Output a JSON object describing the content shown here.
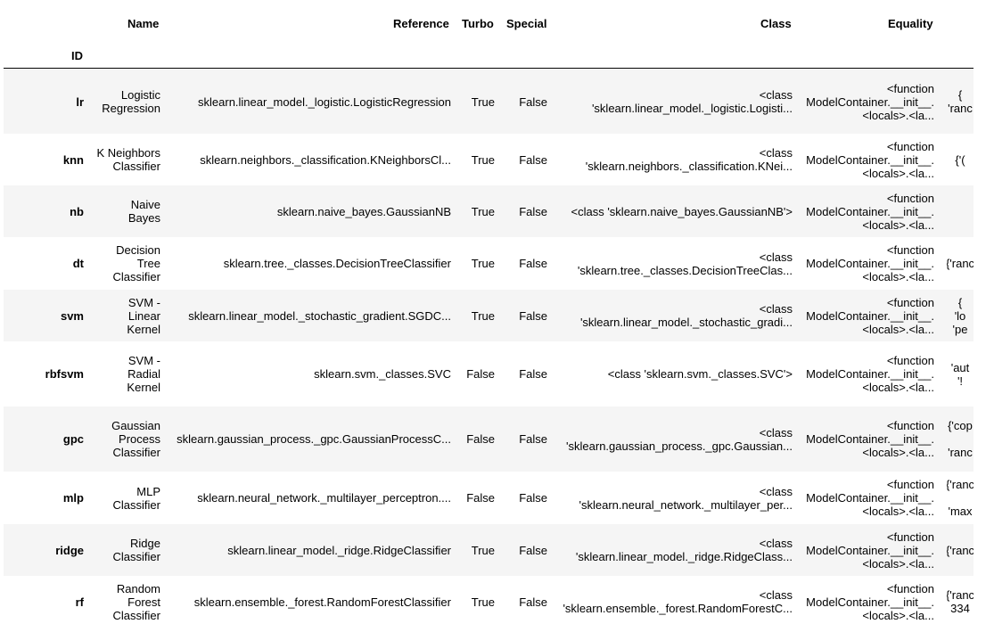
{
  "table": {
    "columns": {
      "index": "ID",
      "name": "Name",
      "reference": "Reference",
      "turbo": "Turbo",
      "special": "Special",
      "class": "Class",
      "equality": "Equality"
    },
    "rows": [
      {
        "id": "lr",
        "name": [
          "Logistic",
          "Regression"
        ],
        "reference": "sklearn.linear_model._logistic.LogisticRegression",
        "turbo": "True",
        "special": "False",
        "class": [
          "<class",
          "'sklearn.linear_model._logistic.Logisti..."
        ],
        "equality": [
          "<function",
          "ModelContainer.__init__.",
          "<locals>.<la..."
        ],
        "extra": [
          "{",
          "'ranc"
        ]
      },
      {
        "id": "knn",
        "name": [
          "K Neighbors",
          "Classifier"
        ],
        "reference": "sklearn.neighbors._classification.KNeighborsCl...",
        "turbo": "True",
        "special": "False",
        "class": [
          "<class",
          "'sklearn.neighbors._classification.KNei..."
        ],
        "equality": [
          "<function",
          "ModelContainer.__init__.",
          "<locals>.<la..."
        ],
        "extra": [
          "{'("
        ]
      },
      {
        "id": "nb",
        "name": [
          "Naive",
          "Bayes"
        ],
        "reference": "sklearn.naive_bayes.GaussianNB",
        "turbo": "True",
        "special": "False",
        "class": [
          "<class 'sklearn.naive_bayes.GaussianNB'>"
        ],
        "equality": [
          "<function",
          "ModelContainer.__init__.",
          "<locals>.<la..."
        ],
        "extra": []
      },
      {
        "id": "dt",
        "name": [
          "Decision",
          "Tree",
          "Classifier"
        ],
        "reference": "sklearn.tree._classes.DecisionTreeClassifier",
        "turbo": "True",
        "special": "False",
        "class": [
          "<class",
          "'sklearn.tree._classes.DecisionTreeClas..."
        ],
        "equality": [
          "<function",
          "ModelContainer.__init__.",
          "<locals>.<la..."
        ],
        "extra": [
          "{'ranc"
        ]
      },
      {
        "id": "svm",
        "name": [
          "SVM -",
          "Linear",
          "Kernel"
        ],
        "reference": "sklearn.linear_model._stochastic_gradient.SGDC...",
        "turbo": "True",
        "special": "False",
        "class": [
          "<class",
          "'sklearn.linear_model._stochastic_gradi..."
        ],
        "equality": [
          "<function",
          "ModelContainer.__init__.",
          "<locals>.<la..."
        ],
        "extra": [
          "{",
          "'lo",
          "'pe"
        ]
      },
      {
        "id": "rbfsvm",
        "name": [
          "SVM -",
          "Radial",
          "Kernel"
        ],
        "reference": "sklearn.svm._classes.SVC",
        "turbo": "False",
        "special": "False",
        "class": [
          "<class 'sklearn.svm._classes.SVC'>"
        ],
        "equality": [
          "<function",
          "ModelContainer.__init__.",
          "<locals>.<la..."
        ],
        "extra": [
          "'aut",
          "'!"
        ]
      },
      {
        "id": "gpc",
        "name": [
          "Gaussian",
          "Process",
          "Classifier"
        ],
        "reference": "sklearn.gaussian_process._gpc.GaussianProcessC...",
        "turbo": "False",
        "special": "False",
        "class": [
          "<class",
          "'sklearn.gaussian_process._gpc.Gaussian..."
        ],
        "equality": [
          "<function",
          "ModelContainer.__init__.",
          "<locals>.<la..."
        ],
        "extra": [
          "{'cop",
          "",
          "'ranc"
        ]
      },
      {
        "id": "mlp",
        "name": [
          "MLP",
          "Classifier"
        ],
        "reference": "sklearn.neural_network._multilayer_perceptron....",
        "turbo": "False",
        "special": "False",
        "class": [
          "<class",
          "'sklearn.neural_network._multilayer_per..."
        ],
        "equality": [
          "<function",
          "ModelContainer.__init__.",
          "<locals>.<la..."
        ],
        "extra": [
          "{'ranc",
          "",
          "'max"
        ]
      },
      {
        "id": "ridge",
        "name": [
          "Ridge",
          "Classifier"
        ],
        "reference": "sklearn.linear_model._ridge.RidgeClassifier",
        "turbo": "True",
        "special": "False",
        "class": [
          "<class",
          "'sklearn.linear_model._ridge.RidgeClass..."
        ],
        "equality": [
          "<function",
          "ModelContainer.__init__.",
          "<locals>.<la..."
        ],
        "extra": [
          "{'ranc"
        ]
      },
      {
        "id": "rf",
        "name": [
          "Random",
          "Forest",
          "Classifier"
        ],
        "reference": "sklearn.ensemble._forest.RandomForestClassifier",
        "turbo": "True",
        "special": "False",
        "class": [
          "<class",
          "'sklearn.ensemble._forest.RandomForestC..."
        ],
        "equality": [
          "<function",
          "ModelContainer.__init__.",
          "<locals>.<la..."
        ],
        "extra": [
          "{'ranc",
          "334"
        ]
      }
    ]
  }
}
